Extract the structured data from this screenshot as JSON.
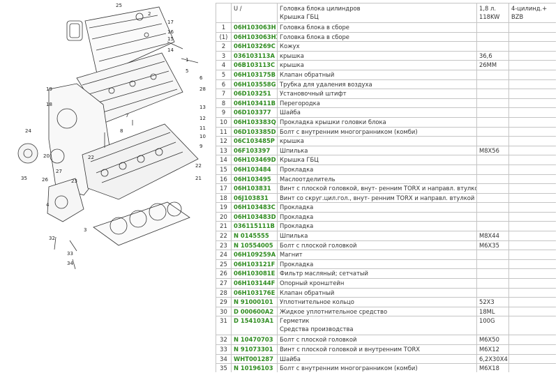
{
  "header": {
    "num": "",
    "part": "U /",
    "desc": [
      "Головка блока цилиндров",
      "Крышка ГБЦ"
    ],
    "note": [
      "1,8 л.",
      "118KW"
    ],
    "extra": [
      "4-цилинд.+",
      "BZB"
    ]
  },
  "rows": [
    {
      "num": "1",
      "part": "06H103063H",
      "desc": [
        "Головка блока в сборе"
      ],
      "note": ""
    },
    {
      "num": "(1)",
      "part": "06H103063HX",
      "desc": [
        "Головка блока в сборе"
      ],
      "note": ""
    },
    {
      "num": "2",
      "part": "06H103269C",
      "desc": [
        "Кожух"
      ],
      "note": ""
    },
    {
      "num": "3",
      "part": "036103113A",
      "desc": [
        "крышка"
      ],
      "note": "36,6"
    },
    {
      "num": "4",
      "part": "06B103113C",
      "desc": [
        "крышка"
      ],
      "note": "26MM"
    },
    {
      "num": "5",
      "part": "06H103175B",
      "desc": [
        "Клапан обратный"
      ],
      "note": ""
    },
    {
      "num": "6",
      "part": "06H103558G",
      "desc": [
        "Трубка для удаления воздуха"
      ],
      "note": ""
    },
    {
      "num": "7",
      "part": "06D103251",
      "desc": [
        "Установочный штифт"
      ],
      "note": ""
    },
    {
      "num": "8",
      "part": "06H103411B",
      "desc": [
        "Перегородка"
      ],
      "note": ""
    },
    {
      "num": "9",
      "part": "06D103377",
      "desc": [
        "Шайба"
      ],
      "note": ""
    },
    {
      "num": "10",
      "part": "06H103383Q",
      "desc": [
        "Прокладка крышки головки блока"
      ],
      "note": ""
    },
    {
      "num": "11",
      "part": "06D103385D",
      "desc": [
        "Болт с внутренним многогранником (комби)"
      ],
      "note": ""
    },
    {
      "num": "12",
      "part": "06C103485P",
      "desc": [
        "крышка"
      ],
      "note": ""
    },
    {
      "num": "13",
      "part": "06F103397",
      "desc": [
        "Шпилька"
      ],
      "note": "M8X56"
    },
    {
      "num": "14",
      "part": "06H103469D",
      "desc": [
        "Крышка ГБЦ"
      ],
      "note": ""
    },
    {
      "num": "15",
      "part": "06H103484",
      "desc": [
        "Прокладка"
      ],
      "note": ""
    },
    {
      "num": "16",
      "part": "06H103495",
      "desc": [
        "Маслоотделитель"
      ],
      "note": ""
    },
    {
      "num": "17",
      "part": "06H103831",
      "desc": [
        "Винт с плоской головкой, внут- ренним TORX и направл. втулкой"
      ],
      "note": ""
    },
    {
      "num": "18",
      "part": "06J103831",
      "desc": [
        "Винт со скруг.цил.гол., внут- ренним TORX и направл. втулкой"
      ],
      "note": ""
    },
    {
      "num": "19",
      "part": "06H103483C",
      "desc": [
        "Прокладка"
      ],
      "note": ""
    },
    {
      "num": "20",
      "part": "06H103483D",
      "desc": [
        "Прокладка"
      ],
      "note": ""
    },
    {
      "num": "21",
      "part": "036115111B",
      "desc": [
        "Прокладка"
      ],
      "note": ""
    },
    {
      "num": "22",
      "part": "N 0145555",
      "desc": [
        "Шпилька"
      ],
      "note": "M8X44"
    },
    {
      "num": "23",
      "part": "N 10554005",
      "desc": [
        "Болт с плоской головкой"
      ],
      "note": "M6X35"
    },
    {
      "num": "24",
      "part": "06H109259A",
      "desc": [
        "Магнит"
      ],
      "note": ""
    },
    {
      "num": "25",
      "part": "06H103121F",
      "desc": [
        "Прокладка"
      ],
      "note": ""
    },
    {
      "num": "26",
      "part": "06H103081E",
      "desc": [
        "Фильтр масляный; сетчатый"
      ],
      "note": ""
    },
    {
      "num": "27",
      "part": "06H103144F",
      "desc": [
        "Опорный кронштейн"
      ],
      "note": ""
    },
    {
      "num": "28",
      "part": "06H103176E",
      "desc": [
        "Клапан обратный"
      ],
      "note": ""
    },
    {
      "num": "29",
      "part": "N 91000101",
      "desc": [
        "Уплотнительное кольцо"
      ],
      "note": "52X3"
    },
    {
      "num": "30",
      "part": "D 000600A2",
      "desc": [
        "Жидкое уплотнительное средство"
      ],
      "note": "18ML"
    },
    {
      "num": "31",
      "part": "D 154103A1",
      "desc": [
        "Герметик",
        "Средства производства"
      ],
      "note": "100G"
    },
    {
      "num": "32",
      "part": "N 10470703",
      "desc": [
        "Болт с плоской головкой"
      ],
      "note": "M6X50"
    },
    {
      "num": "33",
      "part": "N 91073301",
      "desc": [
        "Винт с плоской головкой и внутренним TORX"
      ],
      "note": "M6X12"
    },
    {
      "num": "34",
      "part": "WHT001287",
      "desc": [
        "Шайба"
      ],
      "note": "6,2X30X4"
    },
    {
      "num": "35",
      "part": "N 10196103",
      "desc": [
        "Болт с внутренним многогранником (комби)"
      ],
      "note": "M6X18"
    }
  ],
  "callouts": [
    "25",
    "2",
    "17",
    "16",
    "15",
    "14",
    "1",
    "5",
    "6",
    "28",
    "19",
    "18",
    "13",
    "12",
    "11",
    "10",
    "9",
    "24",
    "20",
    "22",
    "8",
    "7",
    "35",
    "26",
    "27",
    "23",
    "4",
    "3",
    "32",
    "22",
    "21",
    "33",
    "34"
  ],
  "colors": {
    "part": "#2e8b1f",
    "border": "#c4c4c4"
  }
}
